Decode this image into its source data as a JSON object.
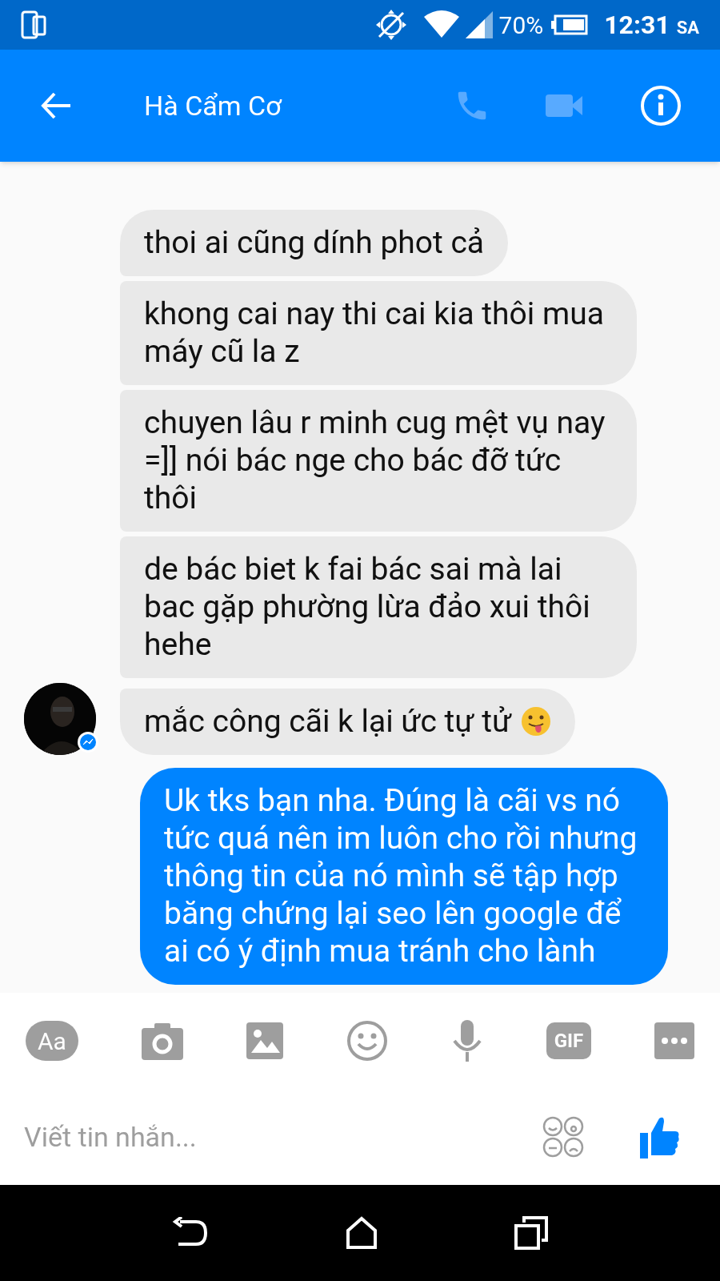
{
  "status_bar": {
    "battery": "70%",
    "time": "12:31",
    "period": "SA"
  },
  "header": {
    "title": "Hà Cẩm Cơ"
  },
  "messages": [
    {
      "kind": "received",
      "text": "thoi ai cũng dính phot cả",
      "emoji": false,
      "avatar": false
    },
    {
      "kind": "received",
      "text": "khong cai nay thi cai kia thôi mua máy cũ la z",
      "emoji": false,
      "avatar": false
    },
    {
      "kind": "received",
      "text": "chuyen lâu r minh cug mệt vụ nay =]] nói bác nge cho bác đỡ tức thôi",
      "emoji": false,
      "avatar": false
    },
    {
      "kind": "received",
      "text": "de bác biet k fai bác sai mà lai bac gặp phường lừa đảo xui thôi hehe",
      "emoji": false,
      "avatar": false
    },
    {
      "kind": "received",
      "text": "mắc công cãi k lại ức tự tử",
      "emoji": true,
      "avatar": true
    },
    {
      "kind": "sent",
      "text": "Uk tks bạn nha. Đúng là cãi vs nó tức quá nên im luôn cho rồi nhưng thông tin của nó mình sẽ tập hợp băng chứng lại seo lên google để ai có ý định mua tránh cho lành"
    }
  ],
  "composer_tools": {
    "text_style": "Aa",
    "gif": "GIF"
  },
  "composer": {
    "placeholder": "Viết tin nhắn..."
  }
}
